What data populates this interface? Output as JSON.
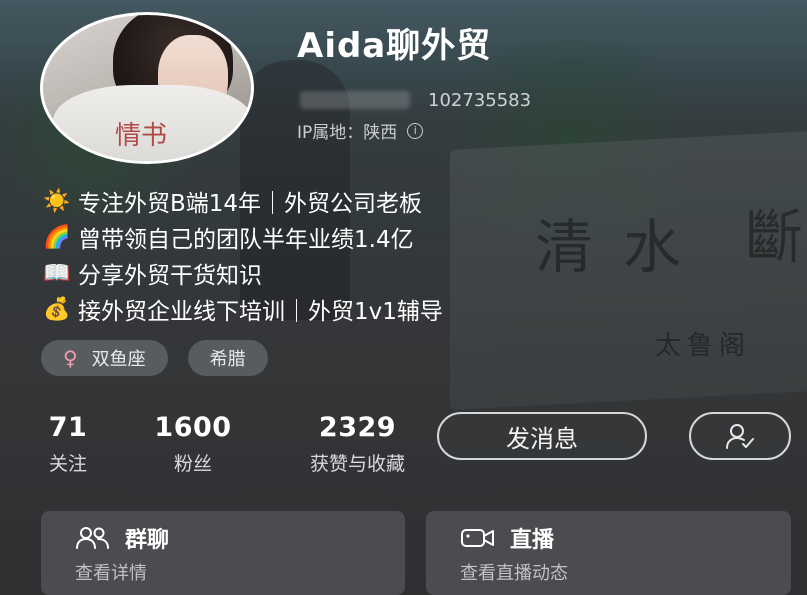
{
  "profile": {
    "name": "Aida聊外贸",
    "id": "102735583",
    "ip_location": "IP属地：陕西",
    "avatar_text": "情书"
  },
  "bio": [
    {
      "icon": "sun-emoji",
      "glyph": "☀️",
      "text": "专注外贸B端14年｜外贸公司老板"
    },
    {
      "icon": "rainbow-emoji",
      "glyph": "🌈",
      "text": "曾带领自己的团队半年业绩1.4亿"
    },
    {
      "icon": "book-emoji",
      "glyph": "📖",
      "text": "分享外贸干货知识"
    },
    {
      "icon": "money-bag-emoji",
      "glyph": "💰",
      "text": "接外贸企业线下培训｜外贸1v1辅导"
    }
  ],
  "tags": {
    "zodiac": "双鱼座",
    "location": "希腊",
    "gender_glyph": "♀"
  },
  "stats": {
    "following": {
      "value": "71",
      "label": "关注"
    },
    "followers": {
      "value": "1600",
      "label": "粉丝"
    },
    "likes": {
      "value": "2329",
      "label": "获赞与收藏"
    }
  },
  "actions": {
    "message": "发消息"
  },
  "cards": {
    "group_chat": {
      "title": "群聊",
      "subtitle": "查看详情"
    },
    "live": {
      "title": "直播",
      "subtitle": "查看直播动态"
    }
  },
  "background": {
    "calligraphy_1": "清水",
    "calligraphy_2": "斷",
    "calligraphy_3": "太鲁阁"
  },
  "colors": {
    "gender_icon": "#f19bb2",
    "card_bg": "#4b4c4f"
  }
}
